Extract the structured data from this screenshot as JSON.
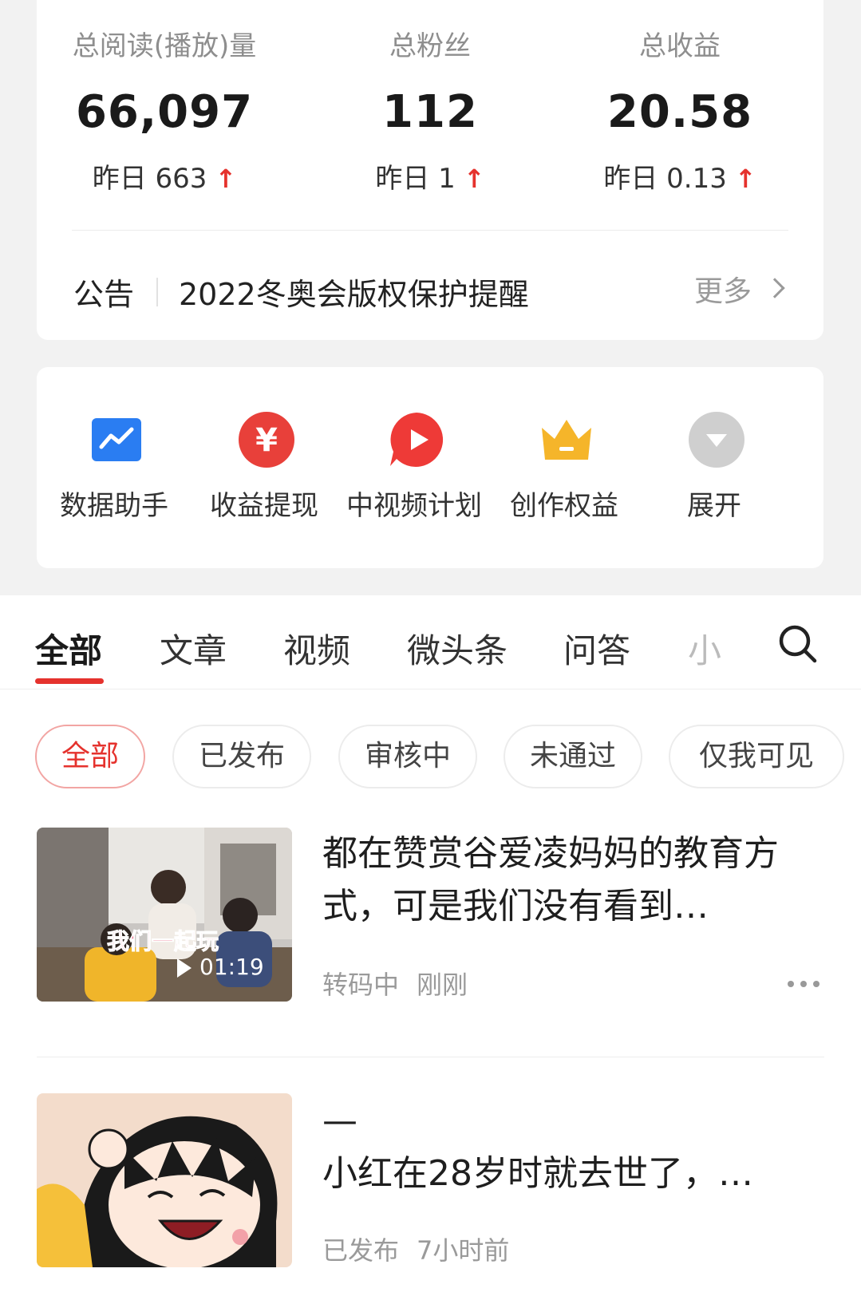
{
  "stats": [
    {
      "label": "总阅读(播放)量",
      "value": "66,097",
      "yesterday_label": "昨日",
      "yesterday_value": "663",
      "trend": "↑"
    },
    {
      "label": "总粉丝",
      "value": "112",
      "yesterday_label": "昨日",
      "yesterday_value": "1",
      "trend": "↑"
    },
    {
      "label": "总收益",
      "value": "20.58",
      "yesterday_label": "昨日",
      "yesterday_value": "0.13",
      "trend": "↑"
    }
  ],
  "notice": {
    "tag": "公告",
    "text": "2022冬奥会版权保护提醒",
    "more": "更多"
  },
  "tools": [
    {
      "label": "数据助手",
      "icon": "data-chart-icon"
    },
    {
      "label": "收益提现",
      "icon": "yuan-coin-icon"
    },
    {
      "label": "中视频计划",
      "icon": "video-play-icon"
    },
    {
      "label": "创作权益",
      "icon": "crown-icon"
    },
    {
      "label": "展开",
      "icon": "expand-down-icon"
    }
  ],
  "tabs": [
    "全部",
    "文章",
    "视频",
    "微头条",
    "问答",
    "小"
  ],
  "filters": [
    "全部",
    "已发布",
    "审核中",
    "未通过",
    "仅我可见"
  ],
  "items": [
    {
      "title": "都在赞赏谷爱凌妈妈的教育方式，可是我们没有看到…",
      "status": "转码中",
      "time": "刚刚",
      "thumb_caption": "我们一起玩",
      "duration": "01:19"
    },
    {
      "title_prefix": "—",
      "title": "小红在28岁时就去世了，…",
      "status": "已发布",
      "time": "7小时前"
    }
  ],
  "colors": {
    "accent": "#e5322d",
    "blue": "#2a7df2",
    "gold": "#f5b52a",
    "gray": "#c8c8c8"
  }
}
